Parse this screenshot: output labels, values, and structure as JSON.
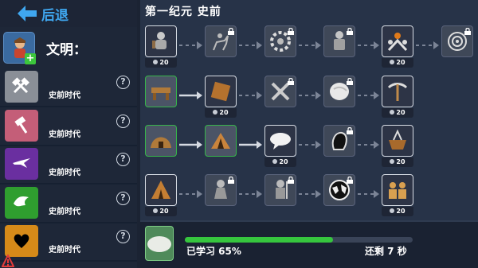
{
  "header": {
    "back_label": "后退",
    "era_title": "第一纪元 史前"
  },
  "civilization": {
    "label": "文明："
  },
  "categories": [
    {
      "name": "史前时代",
      "color": "#8a8f97",
      "icon": "hammer-crossed-icon"
    },
    {
      "name": "史前时代",
      "color": "#c45e78",
      "icon": "hammer-icon"
    },
    {
      "name": "史前时代",
      "color": "#6a2fa0",
      "icon": "bird-icon"
    },
    {
      "name": "史前时代",
      "color": "#2f9e2f",
      "icon": "dove-icon"
    },
    {
      "name": "史前时代",
      "color": "#d68a19",
      "icon": "heart-icon"
    }
  ],
  "help_symbol": "?",
  "tech_rows": [
    {
      "nodes": [
        {
          "icon": "warrior-icon",
          "state": "avail",
          "cost": "20"
        },
        {
          "icon": "horse-rider-icon",
          "state": "locked",
          "cost": ""
        },
        {
          "icon": "gear-ring-icon",
          "state": "locked",
          "cost": ""
        },
        {
          "icon": "armored-figure-icon",
          "state": "locked",
          "cost": ""
        },
        {
          "icon": "council-icon",
          "state": "avail",
          "cost": "20"
        },
        {
          "icon": "signal-icon",
          "state": "locked",
          "cost": ""
        }
      ]
    },
    {
      "nodes": [
        {
          "icon": "workbench-icon",
          "state": "done",
          "cost": ""
        },
        {
          "icon": "scroll-icon",
          "state": "avail",
          "cost": "20"
        },
        {
          "icon": "tools-crossed-icon",
          "state": "locked",
          "cost": ""
        },
        {
          "icon": "stone-icon",
          "state": "locked",
          "cost": ""
        },
        {
          "icon": "pickaxe-icon",
          "state": "avail",
          "cost": "20"
        }
      ]
    },
    {
      "nodes": [
        {
          "icon": "hut-icon",
          "state": "done",
          "cost": ""
        },
        {
          "icon": "tent-icon",
          "state": "done",
          "cost": ""
        },
        {
          "icon": "speech-bubble-icon",
          "state": "avail",
          "cost": "20"
        },
        {
          "icon": "head-silhouette-icon",
          "state": "locked",
          "cost": ""
        },
        {
          "icon": "fire-pot-icon",
          "state": "avail",
          "cost": "20"
        }
      ]
    },
    {
      "nodes": [
        {
          "icon": "tepee-icon",
          "state": "avail",
          "cost": "20"
        },
        {
          "icon": "robed-figure-icon",
          "state": "locked",
          "cost": ""
        },
        {
          "icon": "soldier-icon",
          "state": "locked",
          "cost": ""
        },
        {
          "icon": "globe-icon",
          "state": "locked",
          "cost": ""
        },
        {
          "icon": "people-icon",
          "state": "avail",
          "cost": "20"
        }
      ]
    }
  ],
  "progress": {
    "fraction": 0.65,
    "learned_label": "已学习 65%",
    "remaining_label": "还剩 7 秒"
  }
}
